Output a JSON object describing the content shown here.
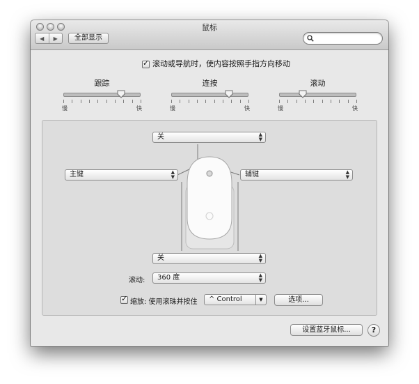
{
  "window": {
    "title": "鼠标",
    "show_all_label": "全部显示",
    "search_placeholder": ""
  },
  "scroll_direction": {
    "checked": true,
    "label": "滚动或导航时，使内容按照手指方向移动"
  },
  "sliders": [
    {
      "title": "跟踪",
      "min_label": "慢",
      "max_label": "快",
      "value": 0.75
    },
    {
      "title": "连按",
      "min_label": "慢",
      "max_label": "快",
      "value": 0.75
    },
    {
      "title": "滚动",
      "min_label": "慢",
      "max_label": "快",
      "value": 0.3
    }
  ],
  "mouse_buttons": {
    "top": "关",
    "left": "主键",
    "right": "辅键",
    "bottom": "关"
  },
  "scrolling": {
    "label": "滚动:",
    "value": "360 度"
  },
  "zoom": {
    "checked": true,
    "label": "缩放:  使用滚珠并按住",
    "modifier": "^ Control",
    "options_button": "选项..."
  },
  "footer": {
    "bluetooth_button": "设置蓝牙鼠标...",
    "help": "?"
  }
}
